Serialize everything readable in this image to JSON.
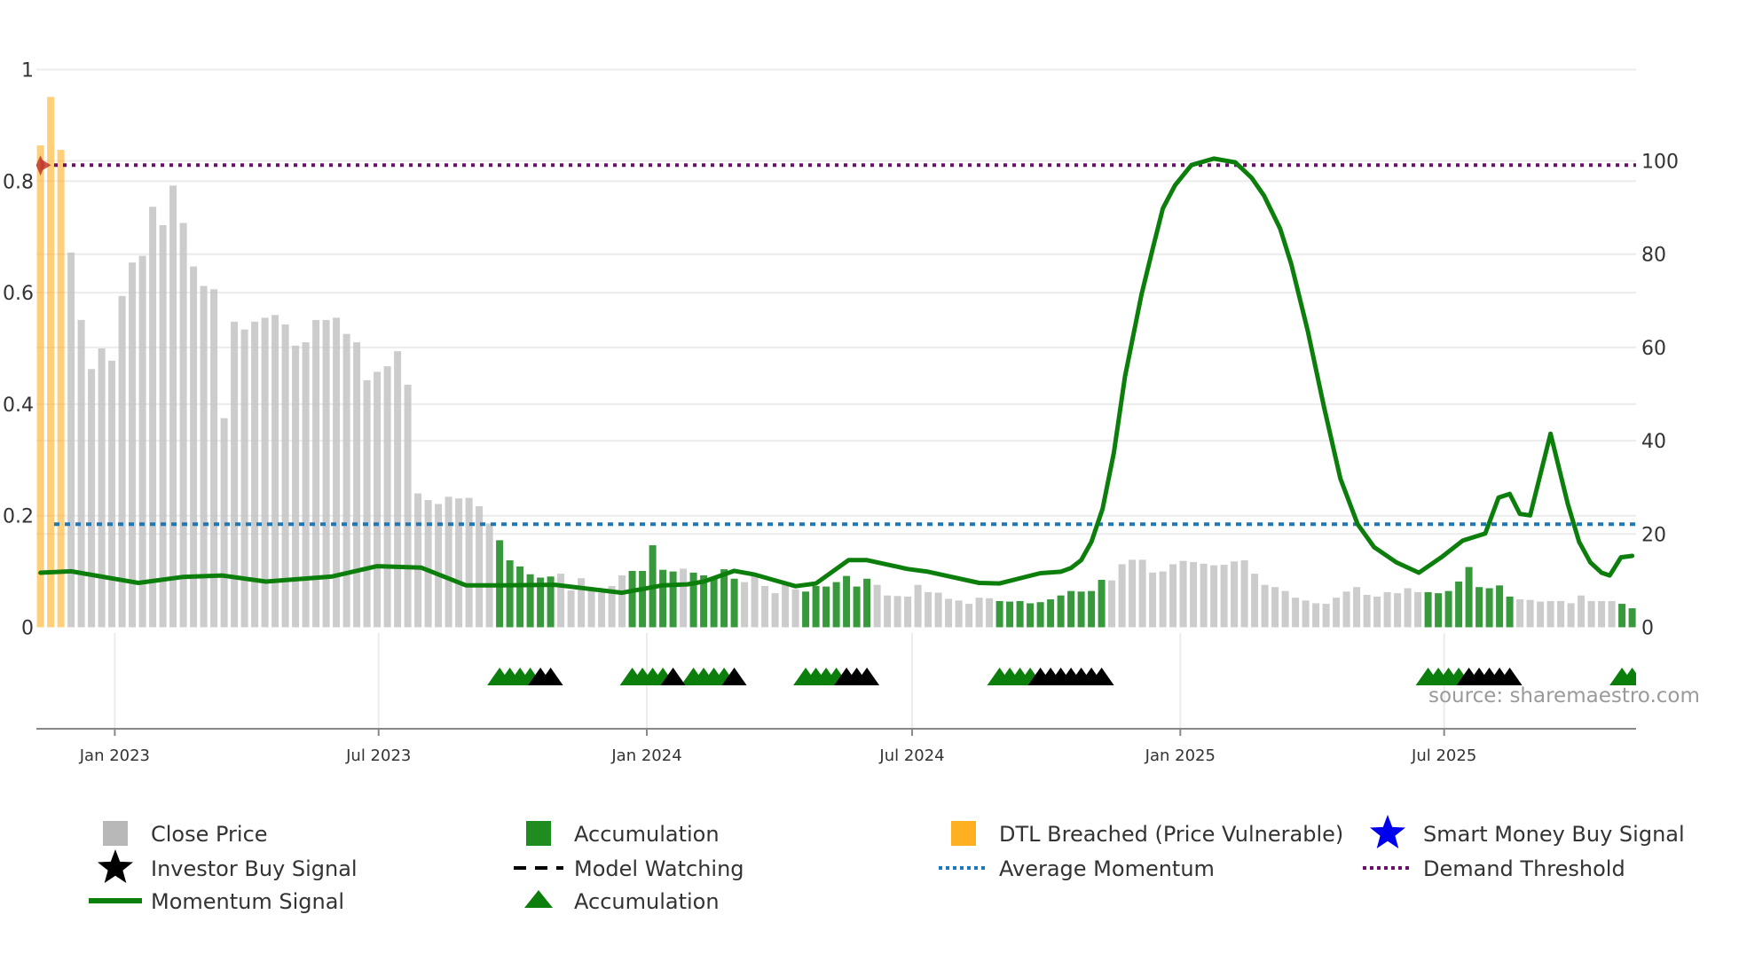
{
  "chart_data": {
    "type": "bar+line",
    "title": "",
    "x_start": "2022-11-11",
    "x_step_days": 7,
    "left_axis": {
      "ylim": [
        0,
        1
      ],
      "ticks": [
        "0",
        "0.2",
        "0.4",
        "0.6",
        "0.8",
        "1"
      ],
      "tick_values": [
        0,
        0.2,
        0.4,
        0.6,
        0.8,
        1
      ]
    },
    "right_axis": {
      "ylim": [
        0,
        100
      ],
      "ticks": [
        "0",
        "20",
        "40",
        "60",
        "80",
        "100"
      ],
      "tick_values": [
        0,
        20,
        40,
        60,
        80,
        100
      ]
    },
    "x_ticks": [
      {
        "date": "2023-01-01",
        "label": "Jan 2023"
      },
      {
        "date": "2023-07-01",
        "label": "Jul 2023"
      },
      {
        "date": "2024-01-01",
        "label": "Jan 2024"
      },
      {
        "date": "2024-07-01",
        "label": "Jul 2024"
      },
      {
        "date": "2025-01-01",
        "label": "Jan 2025"
      },
      {
        "date": "2025-07-01",
        "label": "Jul 2025"
      }
    ],
    "close_price": [
      0.864,
      0.951,
      0.856,
      0.672,
      0.551,
      0.463,
      0.5,
      0.478,
      0.594,
      0.654,
      0.666,
      0.754,
      0.721,
      0.792,
      0.725,
      0.647,
      0.612,
      0.606,
      0.375,
      0.548,
      0.534,
      0.548,
      0.555,
      0.56,
      0.543,
      0.505,
      0.511,
      0.551,
      0.551,
      0.555,
      0.526,
      0.511,
      0.443,
      0.458,
      0.468,
      0.495,
      0.435,
      0.24,
      0.228,
      0.221,
      0.234,
      0.231,
      0.232,
      0.217,
      0.186,
      0.156,
      0.12,
      0.109,
      0.095,
      0.089,
      0.091,
      0.096,
      0.066,
      0.088,
      0.067,
      0.062,
      0.074,
      0.093,
      0.101,
      0.101,
      0.147,
      0.103,
      0.1,
      0.105,
      0.098,
      0.093,
      0.087,
      0.104,
      0.087,
      0.081,
      0.094,
      0.074,
      0.061,
      0.079,
      0.068,
      0.064,
      0.074,
      0.073,
      0.081,
      0.092,
      0.073,
      0.087,
      0.076,
      0.057,
      0.056,
      0.055,
      0.076,
      0.063,
      0.062,
      0.051,
      0.048,
      0.042,
      0.053,
      0.052,
      0.047,
      0.046,
      0.047,
      0.043,
      0.045,
      0.05,
      0.057,
      0.065,
      0.064,
      0.065,
      0.085,
      0.084,
      0.113,
      0.121,
      0.121,
      0.098,
      0.1,
      0.113,
      0.119,
      0.117,
      0.114,
      0.111,
      0.112,
      0.118,
      0.12,
      0.096,
      0.076,
      0.072,
      0.065,
      0.053,
      0.048,
      0.043,
      0.042,
      0.053,
      0.064,
      0.072,
      0.058,
      0.055,
      0.063,
      0.061,
      0.07,
      0.063,
      0.063,
      0.061,
      0.065,
      0.082,
      0.108,
      0.072,
      0.07,
      0.075,
      0.055,
      0.05,
      0.049,
      0.046,
      0.047,
      0.047,
      0.043,
      0.057,
      0.047,
      0.047,
      0.047,
      0.042,
      0.034
    ],
    "bar_category_ranges": [
      {
        "from": 0,
        "to": 2,
        "category": "dtl_breached"
      },
      {
        "from": 3,
        "to": 44,
        "category": "close"
      },
      {
        "from": 45,
        "to": 50,
        "category": "accumulation"
      },
      {
        "from": 51,
        "to": 57,
        "category": "close"
      },
      {
        "from": 58,
        "to": 62,
        "category": "accumulation"
      },
      {
        "from": 63,
        "to": 63,
        "category": "close"
      },
      {
        "from": 64,
        "to": 68,
        "category": "accumulation"
      },
      {
        "from": 69,
        "to": 74,
        "category": "close"
      },
      {
        "from": 75,
        "to": 81,
        "category": "accumulation"
      },
      {
        "from": 82,
        "to": 93,
        "category": "close"
      },
      {
        "from": 94,
        "to": 104,
        "category": "accumulation"
      },
      {
        "from": 105,
        "to": 135,
        "category": "close"
      },
      {
        "from": 136,
        "to": 144,
        "category": "accumulation"
      },
      {
        "from": 145,
        "to": 154,
        "category": "close"
      },
      {
        "from": 155,
        "to": 156,
        "category": "accumulation"
      }
    ],
    "momentum_points": [
      [
        0,
        11.7
      ],
      [
        3,
        12.0
      ],
      [
        9.6,
        9.5
      ],
      [
        14,
        10.8
      ],
      [
        17.8,
        11.1
      ],
      [
        22.1,
        9.8
      ],
      [
        28.6,
        10.9
      ],
      [
        33,
        13.1
      ],
      [
        37.3,
        12.8
      ],
      [
        41.7,
        9.0
      ],
      [
        45,
        9.0
      ],
      [
        50.4,
        9.1
      ],
      [
        57,
        7.4
      ],
      [
        61,
        9.0
      ],
      [
        63.4,
        9.2
      ],
      [
        65,
        9.8
      ],
      [
        68,
        12.1
      ],
      [
        70,
        11.3
      ],
      [
        74,
        8.8
      ],
      [
        76,
        9.4
      ],
      [
        79.2,
        14.4
      ],
      [
        81,
        14.4
      ],
      [
        85,
        12.5
      ],
      [
        87,
        11.9
      ],
      [
        92,
        9.5
      ],
      [
        94,
        9.4
      ],
      [
        98,
        11.6
      ],
      [
        100,
        11.9
      ],
      [
        101,
        12.7
      ],
      [
        102,
        14.4
      ],
      [
        103,
        18.3
      ],
      [
        104.1,
        25.4
      ],
      [
        105.2,
        37.4
      ],
      [
        106.3,
        53.8
      ],
      [
        107.9,
        71.3
      ],
      [
        109,
        81.1
      ],
      [
        110,
        89.8
      ],
      [
        111.2,
        94.8
      ],
      [
        112.8,
        99.1
      ],
      [
        115,
        100.5
      ],
      [
        117.1,
        99.7
      ],
      [
        118.7,
        96.4
      ],
      [
        119.9,
        92.6
      ],
      [
        121.5,
        85.5
      ],
      [
        122.6,
        77.8
      ],
      [
        124.2,
        63.6
      ],
      [
        125.8,
        47.2
      ],
      [
        127.4,
        31.9
      ],
      [
        129.1,
        22.1
      ],
      [
        130.7,
        17.2
      ],
      [
        132.9,
        13.9
      ],
      [
        135.1,
        11.7
      ],
      [
        137.3,
        15.0
      ],
      [
        139.4,
        18.6
      ],
      [
        141.6,
        20.1
      ],
      [
        142.9,
        27.8
      ],
      [
        144,
        28.6
      ],
      [
        145,
        24.3
      ],
      [
        146,
        24.0
      ],
      [
        148,
        41.5
      ],
      [
        149.7,
        26.4
      ],
      [
        150.8,
        18.3
      ],
      [
        151.9,
        13.9
      ],
      [
        153,
        11.7
      ],
      [
        153.8,
        11.1
      ],
      [
        154.9,
        15.0
      ],
      [
        156,
        15.3
      ]
    ],
    "average_momentum": 22.1,
    "demand_threshold": 99.1,
    "accumulation_markers": [
      45,
      46,
      47,
      48,
      58,
      59,
      60,
      61,
      64,
      65,
      66,
      67,
      75,
      76,
      77,
      78,
      94,
      95,
      96,
      97,
      136,
      137,
      138,
      139,
      155,
      156
    ],
    "black_markers": [
      49,
      50,
      62,
      68,
      79,
      80,
      81,
      98,
      99,
      100,
      101,
      102,
      103,
      104,
      140,
      141,
      142,
      143,
      144
    ],
    "dtl_breach_marker_week": 0,
    "colors": {
      "close": "#c3c3c3",
      "accumulation": "#14871a",
      "dtl": "#ffb020",
      "momentum": "#0b7e0b",
      "average": "#1f77b4",
      "demand": "#6b0f6b",
      "investor": "#000000",
      "smart_money": "#0000ee",
      "breach_marker": "#c0392b"
    },
    "legend": [
      {
        "label": "Close Price",
        "symbol": "square",
        "color": "#b8b8b8"
      },
      {
        "label": "Accumulation",
        "symbol": "square",
        "color": "#1f8c1f"
      },
      {
        "label": "DTL Breached (Price Vulnerable)",
        "symbol": "square",
        "color": "#ffb020"
      },
      {
        "label": "Smart Money Buy Signal",
        "symbol": "star",
        "color": "#0000ee"
      },
      {
        "label": "Investor Buy Signal",
        "symbol": "star",
        "color": "#000000"
      },
      {
        "label": "Model Watching",
        "symbol": "dash",
        "color": "#000000"
      },
      {
        "label": "Average Momentum",
        "symbol": "dot",
        "color": "#1f77b4"
      },
      {
        "label": "Demand Threshold",
        "symbol": "dot",
        "color": "#6b0f6b"
      },
      {
        "label": "Momentum Signal",
        "symbol": "line",
        "color": "#0b7e0b"
      },
      {
        "label": "Accumulation",
        "symbol": "triangle",
        "color": "#0b7e0b"
      }
    ],
    "source": "source: sharemaestro.com"
  }
}
